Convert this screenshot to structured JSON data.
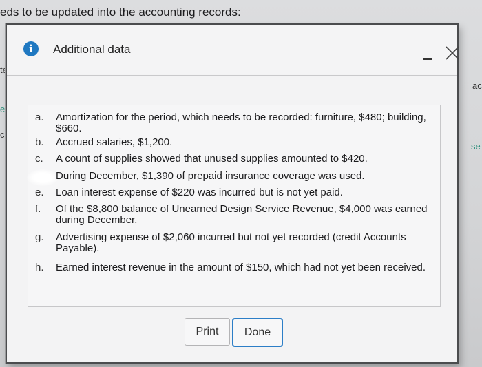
{
  "background": {
    "heading": "eds to be updated into the accounting records:",
    "fragments": [
      "te",
      "e",
      "ac",
      "cc",
      "se"
    ]
  },
  "modal": {
    "title": "Additional data",
    "icons": {
      "info": "info-icon",
      "minimize": "minimize-icon",
      "close": "close-icon"
    },
    "info_glyph": "i",
    "items": [
      {
        "letter": "a.",
        "text": "Amortization for the period, which needs to be recorded: furniture, $480; building, $660."
      },
      {
        "letter": "b.",
        "text": "Accrued salaries, $1,200."
      },
      {
        "letter": "c.",
        "text": "A count of supplies showed that unused supplies amounted to $420."
      },
      {
        "letter": "",
        "text": "During December, $1,390 of prepaid insurance coverage was used."
      },
      {
        "letter": "e.",
        "text": "Loan interest expense of $220 was incurred but is not yet paid."
      },
      {
        "letter": "f.",
        "text": "Of the $8,800 balance of Unearned Design Service Revenue, $4,000 was earned during December."
      },
      {
        "letter": "g.",
        "text": "Advertising expense of $2,060 incurred but not yet recorded (credit Accounts Payable)."
      },
      {
        "letter": "h.",
        "text": "Earned interest revenue in the amount of $150, which had not yet been received."
      }
    ],
    "buttons": {
      "print": "Print",
      "done": "Done"
    }
  }
}
